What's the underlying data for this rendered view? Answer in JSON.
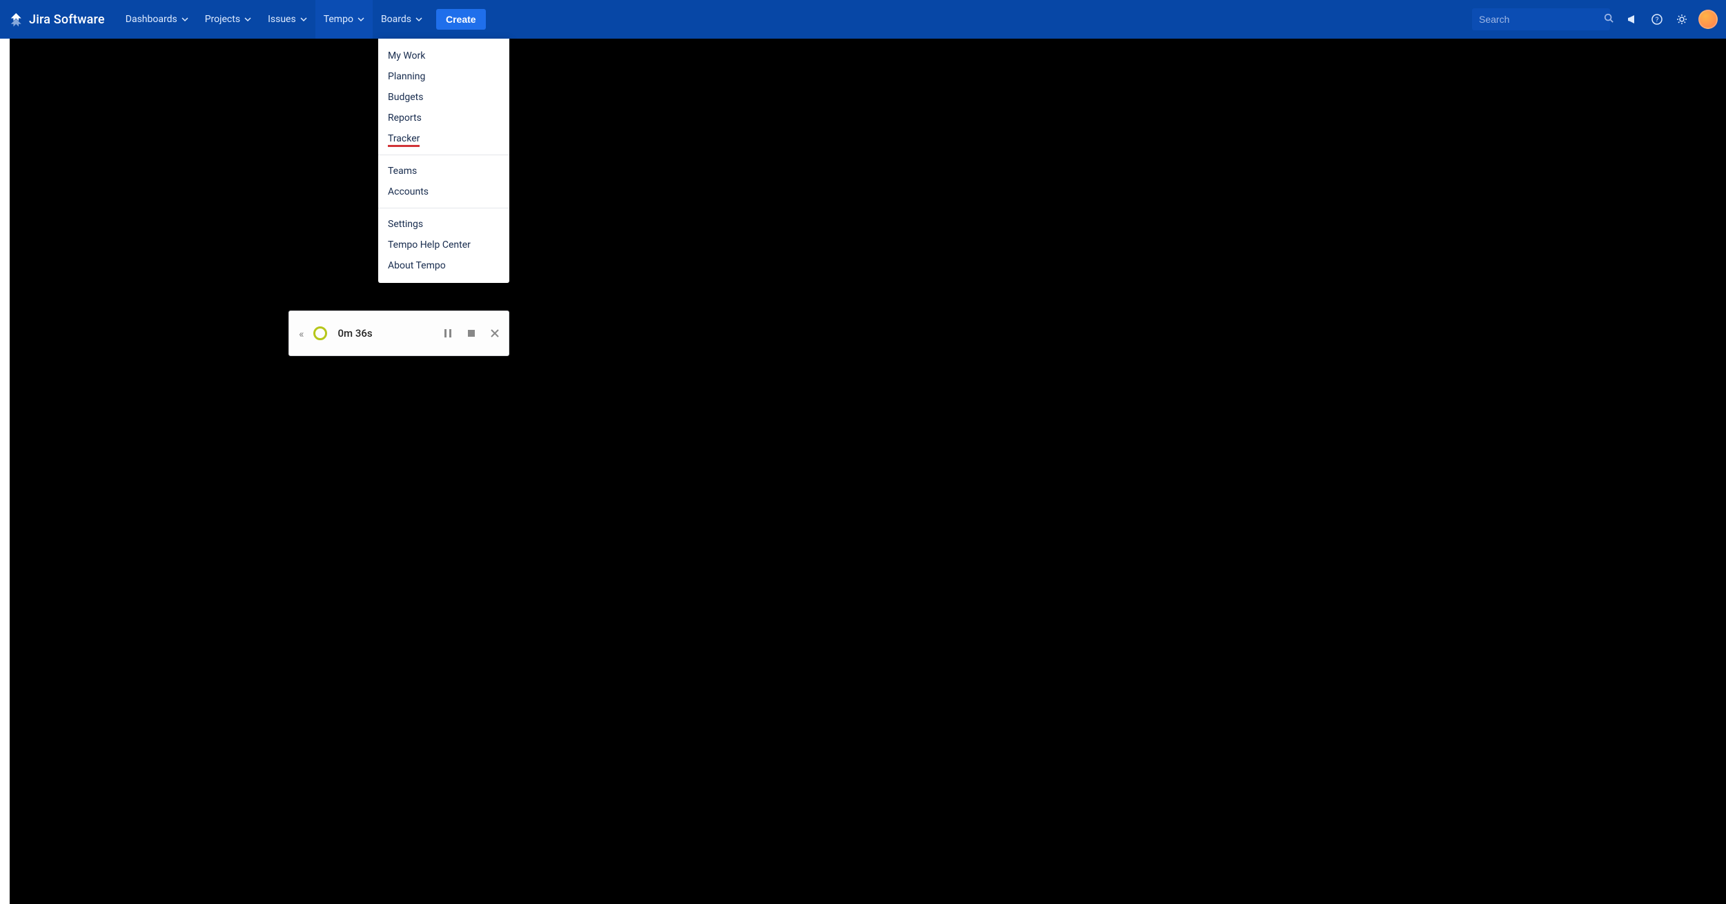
{
  "brand": {
    "name": "Jira Software"
  },
  "nav": {
    "items": [
      {
        "label": "Dashboards"
      },
      {
        "label": "Projects"
      },
      {
        "label": "Issues"
      },
      {
        "label": "Tempo"
      },
      {
        "label": "Boards"
      }
    ],
    "create_label": "Create"
  },
  "search": {
    "placeholder": "Search"
  },
  "tempo_dropdown": {
    "section_a": [
      {
        "label": "My Work"
      },
      {
        "label": "Planning"
      },
      {
        "label": "Budgets"
      },
      {
        "label": "Reports"
      },
      {
        "label": "Tracker",
        "highlight": true
      }
    ],
    "section_b": [
      {
        "label": "Teams"
      },
      {
        "label": "Accounts"
      }
    ],
    "section_c": [
      {
        "label": "Settings"
      },
      {
        "label": "Tempo Help Center"
      },
      {
        "label": "About Tempo"
      }
    ]
  },
  "tracker_widget": {
    "elapsed": "0m 36s"
  }
}
